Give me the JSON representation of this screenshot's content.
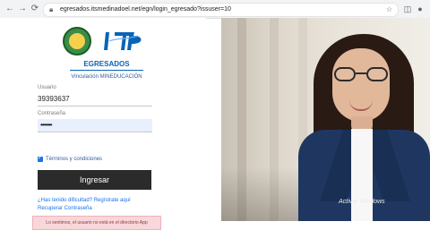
{
  "browser": {
    "url": "egresados.itsmedinadoel.net/egn/login_egresado?issuser=10"
  },
  "login": {
    "portal_title": "EGRESADOS",
    "subtitle": "Vinculación MINEDUCACIÓN",
    "username_label": "Usuario",
    "username_value": "39393637",
    "password_label": "Contraseña",
    "password_value": "•••••••",
    "terms_label": "Términos y condiciones",
    "submit_label": "Ingresar",
    "forgot_link": "¿Has tenido dificultad? Regístrate aquí",
    "recover_link": "Recuperar Contraseña",
    "alert_text": "Lo sentimos, el usuario no está en el directorio App"
  },
  "overlay": {
    "windows_activation": "Activar Windows"
  },
  "colors": {
    "brand_blue": "#0b63b5",
    "button_bg": "#2b2b2b",
    "alert_bg": "#f8d7da"
  }
}
